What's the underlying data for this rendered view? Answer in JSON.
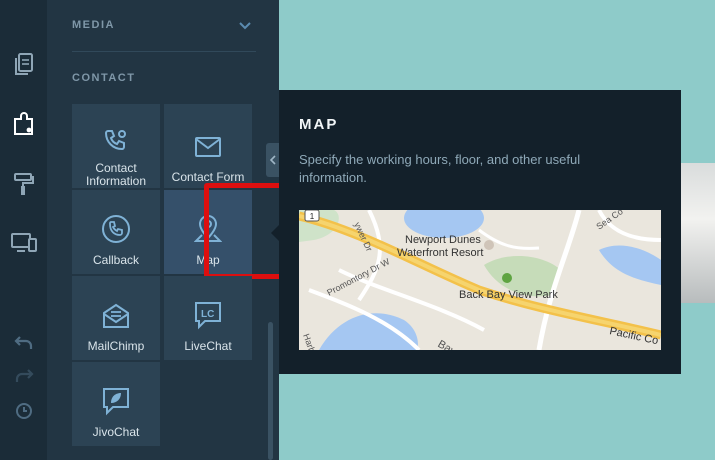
{
  "sidebar": {
    "icons": [
      "pages-icon",
      "apps-icon",
      "design-icon",
      "devices-icon"
    ],
    "footer_icons": [
      "undo-icon",
      "redo-icon",
      "history-icon"
    ]
  },
  "panel": {
    "section_media": "MEDIA",
    "section_contact": "CONTACT",
    "tiles": [
      {
        "label": "Contact Information",
        "icon": "phone-pin-icon"
      },
      {
        "label": "Contact Form",
        "icon": "envelope-icon"
      },
      {
        "label": "Callback",
        "icon": "phone-circle-icon"
      },
      {
        "label": "Map",
        "icon": "map-pin-icon"
      },
      {
        "label": "MailChimp",
        "icon": "mail-icon"
      },
      {
        "label": "LiveChat",
        "icon": "chat-bubble-icon"
      },
      {
        "label": "JivoChat",
        "icon": "leaf-chat-icon"
      }
    ]
  },
  "popover": {
    "title": "MAP",
    "description": "Specify the working hours, floor, and other useful information.",
    "map": {
      "labels": [
        "Newport Dunes",
        "Waterfront Resort",
        "Back Bay View Park",
        "Promontory Dr W",
        "Pacific Co",
        "Sea Co",
        "Bay",
        "Harbor",
        "ywer Dr",
        "1"
      ]
    }
  },
  "colors": {
    "canvas": "#8ecbc9",
    "rail": "#1b2c38",
    "panel": "#223543",
    "tile": "#2c4354",
    "popover": "#13202a",
    "selection": "#dd0f0f"
  }
}
